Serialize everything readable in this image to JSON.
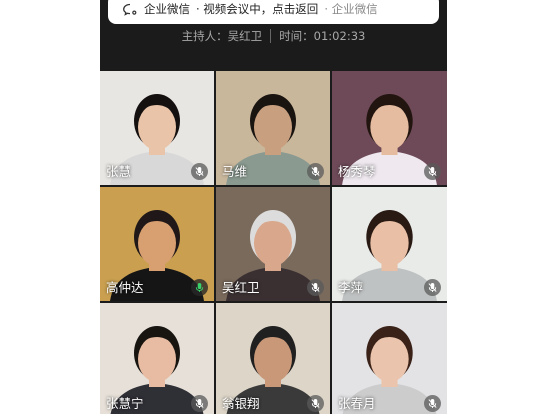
{
  "notification": {
    "app": "企业微信",
    "text": "· 视频会议中，点击返回",
    "source": "· 企业微信"
  },
  "meeting": {
    "host_label": "主持人：",
    "host_name": "吴红卫",
    "time_label": "时间：",
    "time_value": "01:02:33"
  },
  "participants": [
    {
      "name": "张慧",
      "bg": "#e8e6e2",
      "skin": "#e9c4a8",
      "hair": "#141010",
      "cloth": "#d8d8d8",
      "mic": "muted"
    },
    {
      "name": "马维",
      "bg": "#c9b79c",
      "skin": "#c8a080",
      "hair": "#1a1410",
      "cloth": "#8a9a90",
      "mic": "muted"
    },
    {
      "name": "杨秀琴",
      "bg": "#6e4a58",
      "skin": "#e6bca0",
      "hair": "#221510",
      "cloth": "#efe9ef",
      "mic": "muted"
    },
    {
      "name": "高仲达",
      "bg": "#caa050",
      "skin": "#d8a070",
      "hair": "#201818",
      "cloth": "#151515",
      "mic": "active"
    },
    {
      "name": "吴红卫",
      "bg": "#7a6a5c",
      "skin": "#d9a88c",
      "hair": "#dcdcdc",
      "cloth": "#3a3032",
      "mic": "muted"
    },
    {
      "name": "李萍",
      "bg": "#e9ebe9",
      "skin": "#e9c0a6",
      "hair": "#2a1a14",
      "cloth": "#bfc2c2",
      "mic": "muted"
    },
    {
      "name": "张慧宁",
      "bg": "#e6e0d8",
      "skin": "#e7bca2",
      "hair": "#181410",
      "cloth": "#2f2f36",
      "mic": "muted"
    },
    {
      "name": "翁银翔",
      "bg": "#ddd6c8",
      "skin": "#c89878",
      "hair": "#202020",
      "cloth": "#3a3a3a",
      "mic": "muted"
    },
    {
      "name": "张春月",
      "bg": "#e3e3e6",
      "skin": "#eac4ac",
      "hair": "#3a2218",
      "cloth": "#cccccc",
      "mic": "muted"
    }
  ],
  "colors": {
    "phone_bg": "#1b1b1b",
    "meta_text": "#a8a8a8",
    "active_mic": "#3ad06a",
    "muted_mic": "#ffffff"
  }
}
